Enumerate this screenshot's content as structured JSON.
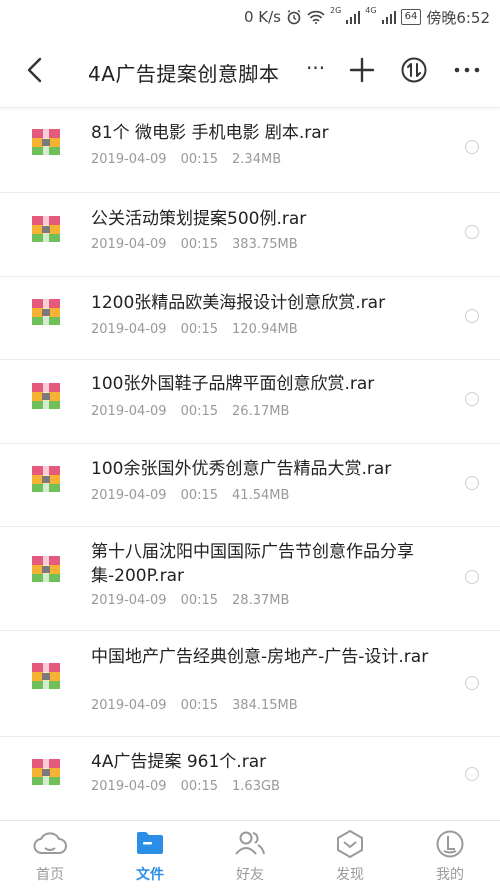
{
  "status": {
    "speed": "0 K/s",
    "net1": "2G",
    "net2": "4G",
    "battery": "64",
    "time": "傍晚6:52"
  },
  "header": {
    "title": "4A广告提案创意脚本",
    "title_more": "···"
  },
  "files": [
    {
      "name": "81个 微电影 手机电影 剧本.rar",
      "date": "2019-04-09",
      "time": "00:15",
      "size": "2.34MB"
    },
    {
      "name": "公关活动策划提案500例.rar",
      "date": "2019-04-09",
      "time": "00:15",
      "size": "383.75MB"
    },
    {
      "name": "1200张精品欧美海报设计创意欣赏.rar",
      "date": "2019-04-09",
      "time": "00:15",
      "size": "120.94MB"
    },
    {
      "name": "100张外国鞋子品牌平面创意欣赏.rar",
      "date": "2019-04-09",
      "time": "00:15",
      "size": "26.17MB"
    },
    {
      "name": "100余张国外优秀创意广告精品大赏.rar",
      "date": "2019-04-09",
      "time": "00:15",
      "size": "41.54MB"
    },
    {
      "name": "第十八届沈阳中国国际广告节创意作品分享集-200P.rar",
      "date": "2019-04-09",
      "time": "00:15",
      "size": "28.37MB"
    },
    {
      "name": "中国地产广告经典创意-房地产-广告-设计.rar",
      "date": "2019-04-09",
      "time": "00:15",
      "size": "384.15MB"
    },
    {
      "name": "4A广告提案 961个.rar",
      "date": "2019-04-09",
      "time": "00:15",
      "size": "1.63GB"
    }
  ],
  "tabs": [
    {
      "label": "首页",
      "icon": "cloud-icon"
    },
    {
      "label": "文件",
      "icon": "folder-icon"
    },
    {
      "label": "好友",
      "icon": "friends-icon"
    },
    {
      "label": "发现",
      "icon": "discover-icon"
    },
    {
      "label": "我的",
      "icon": "profile-icon"
    }
  ],
  "colors": {
    "accent": "#2b8fe8",
    "text": "#222222",
    "meta": "#999999"
  }
}
